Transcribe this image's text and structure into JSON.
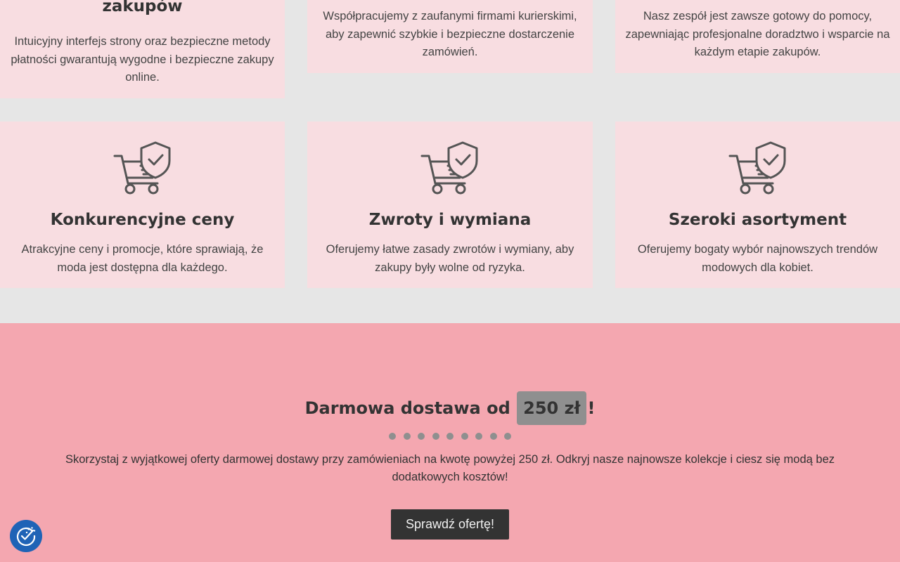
{
  "features_top": [
    {
      "title": "zakupów",
      "text": "Intuicyjny interfejs strony oraz bezpieczne metody płatności gwarantują wygodne i bezpieczne zakupy online."
    },
    {
      "title": "",
      "text": "Współpracujemy z zaufanymi firmami kurierskimi, aby zapewnić szybkie i bezpieczne dostarczenie zamówień."
    },
    {
      "title": "",
      "text": "Nasz zespół jest zawsze gotowy do pomocy, zapewniając profesjonalne doradztwo i wsparcie na każdym etapie zakupów."
    }
  ],
  "features": [
    {
      "icon": "secure-cart-icon",
      "title": "Konkurencyjne ceny",
      "text": "Atrakcyjne ceny i promocje, które sprawiają, że moda jest dostępna dla każdego."
    },
    {
      "icon": "secure-cart-icon",
      "title": "Zwroty i wymiana",
      "text": "Oferujemy łatwe zasady zwrotów i wymiany, aby zakupy były wolne od ryzyka."
    },
    {
      "icon": "secure-cart-icon",
      "title": "Szeroki asortyment",
      "text": "Oferujemy bogaty wybór najnowszych trendów modowych dla kobiet."
    }
  ],
  "promo": {
    "title_before": "Darmowa dostawa od ",
    "title_highlight": "250 zł",
    "title_after": "!",
    "dots_count": 9,
    "text": "Skorzystaj z wyjątkowej oferty darmowej dostawy przy zamówieniach na kwotę powyżej 250 zł. Odkryj nasze najnowsze kolekcje i ciesz się modą bez dodatkowych kosztów!",
    "button_label": "Sprawdź ofertę!"
  },
  "accessibility_button": {
    "icon": "accessibility-icon"
  },
  "colors": {
    "page_bg": "#e6e6e6",
    "card_bg": "#f8dde1",
    "promo_bg": "#f4a7b0",
    "highlight_bg": "#8f8f8f",
    "button_bg": "#333333",
    "accessibility_bg": "#1f63b6"
  }
}
